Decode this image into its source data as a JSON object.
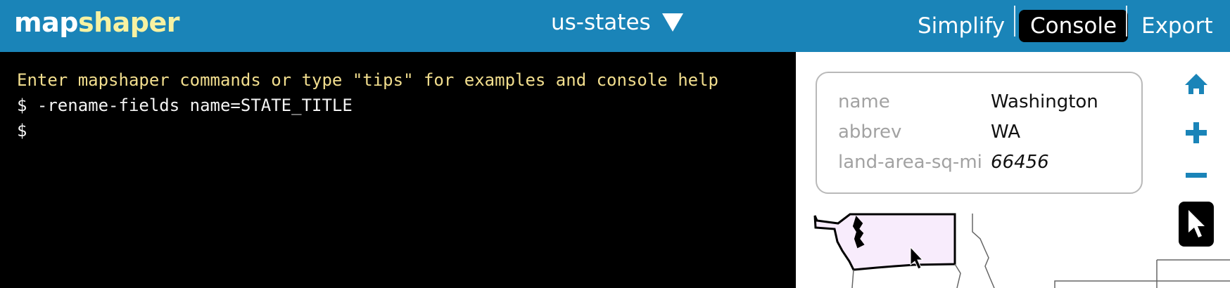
{
  "app": {
    "logo_part1": "map",
    "logo_part2": "shaper",
    "layer_name": "us-states"
  },
  "nav": {
    "simplify": "Simplify",
    "console": "Console",
    "export": "Export"
  },
  "console": {
    "lines": [
      "Enter mapshaper commands or type \"tips\" for examples and console help",
      "$ -rename-fields name=STATE_TITLE",
      "$ "
    ]
  },
  "popup": {
    "rows": [
      {
        "key": "name",
        "value": "Washington"
      },
      {
        "key": "abbrev",
        "value": "WA"
      },
      {
        "key": "land-area-sq-mi",
        "value": "66456"
      }
    ]
  },
  "tools": [
    "home-icon",
    "zoom-in-icon",
    "zoom-out-icon",
    "pointer-icon"
  ],
  "colors": {
    "topbar": "#1a84b8",
    "logo_accent": "#f7f2a2",
    "console_message": "#f2de8e",
    "selected_state_fill": "#f8ecfc",
    "tool_icon": "#1a84b8"
  }
}
